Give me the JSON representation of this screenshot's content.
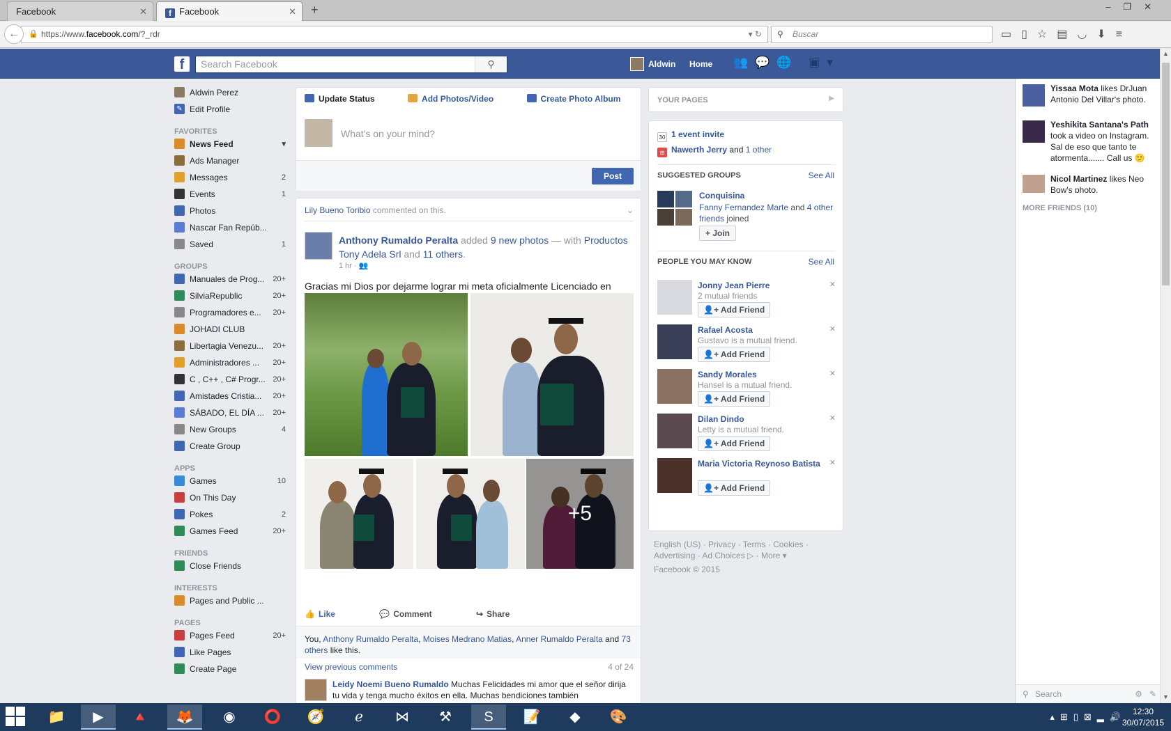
{
  "browser": {
    "tabs": [
      {
        "title": "Facebook"
      },
      {
        "title": "Facebook"
      }
    ],
    "url_prefix": "https://www.",
    "url_host": "facebook.com",
    "url_path": "/?_rdr",
    "search_placeholder": "Buscar"
  },
  "fbbar": {
    "search_placeholder": "Search Facebook",
    "user_name": "Aldwin",
    "home_label": "Home"
  },
  "leftnav": {
    "profile_name": "Aldwin Perez",
    "edit_profile": "Edit Profile",
    "favorites_header": "FAVORITES",
    "favorites": [
      {
        "label": "News Feed",
        "count": ""
      },
      {
        "label": "Ads Manager",
        "count": ""
      },
      {
        "label": "Messages",
        "count": "2"
      },
      {
        "label": "Events",
        "count": "1"
      },
      {
        "label": "Photos",
        "count": ""
      },
      {
        "label": "Nascar Fan Repúb...",
        "count": ""
      },
      {
        "label": "Saved",
        "count": "1"
      }
    ],
    "groups_header": "GROUPS",
    "groups": [
      {
        "label": "Manuales de Prog...",
        "count": "20+"
      },
      {
        "label": "SilviaRepublic",
        "count": "20+"
      },
      {
        "label": "Programadores e...",
        "count": "20+"
      },
      {
        "label": "JOHADI CLUB",
        "count": ""
      },
      {
        "label": "Libertagia Venezu...",
        "count": "20+"
      },
      {
        "label": "Administradores ...",
        "count": "20+"
      },
      {
        "label": "C , C++ , C# Progr...",
        "count": "20+"
      },
      {
        "label": "Amistades Cristia...",
        "count": "20+"
      },
      {
        "label": "SÁBADO, EL DÍA ...",
        "count": "20+"
      },
      {
        "label": "New Groups",
        "count": "4"
      },
      {
        "label": "Create Group",
        "count": ""
      }
    ],
    "apps_header": "APPS",
    "apps": [
      {
        "label": "Games",
        "count": "10"
      },
      {
        "label": "On This Day",
        "count": ""
      },
      {
        "label": "Pokes",
        "count": "2"
      },
      {
        "label": "Games Feed",
        "count": "20+"
      }
    ],
    "friends_header": "FRIENDS",
    "friends": [
      {
        "label": "Close Friends",
        "count": ""
      }
    ],
    "interests_header": "INTERESTS",
    "interests": [
      {
        "label": "Pages and Public ...",
        "count": ""
      }
    ],
    "pages_header": "PAGES",
    "pages": [
      {
        "label": "Pages Feed",
        "count": "20+"
      },
      {
        "label": "Like Pages",
        "count": ""
      },
      {
        "label": "Create Page",
        "count": ""
      }
    ]
  },
  "composer": {
    "tab_update": "Update Status",
    "tab_photos": "Add Photos/Video",
    "tab_album": "Create Photo Album",
    "placeholder": "What's on your mind?",
    "post_label": "Post"
  },
  "story": {
    "context_name": "Lily Bueno Toribio",
    "context_text": "commented on this.",
    "author": "Anthony Rumaldo Peralta",
    "added": "added",
    "photos_link": "9 new photos",
    "with": "— with",
    "tagged": "Productos Tony Adela Srl",
    "and": "and",
    "others_link": "11 others",
    "time": "1 hr",
    "text": "Gracias mi Dios por dejarme lograr mi meta oficialmente Licenciado en enfermería mi Dios es bueno",
    "more_photos": "+5",
    "like": "Like",
    "comment": "Comment",
    "share": "Share",
    "likes_you": "You,",
    "likes_names": [
      "Anthony Rumaldo Peralta",
      "Moises Medrano Matias",
      "Anner Rumaldo Peralta"
    ],
    "likes_and": "and",
    "likes_others": "73 others",
    "likes_suffix": "like this.",
    "view_previous": "View previous comments",
    "comment_count": "4 of 24",
    "commenter": "Leidy Noemi Bueno Rumaldo",
    "comment_text": "Muchas Felicidades mi amor que el señor dirija tu vida y tenga mucho éxitos en ella. Muchas bendiciones también"
  },
  "rightcol": {
    "your_pages": "YOUR PAGES",
    "event_invite": "1 event invite",
    "birthday_name": "Nawerth Jerry",
    "birthday_and": "and",
    "birthday_other": "1 other",
    "suggested_groups": "SUGGESTED GROUPS",
    "see_all": "See All",
    "group_name": "Conquisina",
    "group_joined_name": "Fanny Fernandez Marte",
    "group_joined_and": "and",
    "group_joined_others": "4 other friends",
    "group_joined_suffix": "joined",
    "join_label": "+ Join",
    "pymk_header": "PEOPLE YOU MAY KNOW",
    "pymk": [
      {
        "name": "Jonny Jean Pierre",
        "mutual": "2 mutual friends"
      },
      {
        "name": "Rafael Acosta",
        "mutual": "Gustavo is a mutual friend."
      },
      {
        "name": "Sandy Morales",
        "mutual": "Hansel is a mutual friend."
      },
      {
        "name": "Dilan Dindo",
        "mutual": "Letty is a mutual friend."
      },
      {
        "name": "Maria Victoria Reynoso Batista",
        "mutual": ""
      }
    ],
    "add_friend": "Add Friend",
    "footer_line1": "English (US) · Privacy · Terms · Cookies ·",
    "footer_line2": "Advertising · Ad Choices ▷ · More ▾",
    "footer_copy": "Facebook © 2015"
  },
  "ticker": {
    "items": [
      {
        "name": "Yissaa Mota",
        "text": "likes DrJuan Antonio Del Villar's photo."
      },
      {
        "name": "Yeshikita Santana's Path",
        "text": "took a video on Instagram. Sal de eso que tanto te atormenta....... Call us 🙂"
      },
      {
        "name": "Nicol Martinez",
        "text": "likes Neo Bow's photo."
      }
    ],
    "more_friends": "MORE FRIENDS (10)",
    "chat_search": "Search"
  },
  "taskbar": {
    "time": "12:30",
    "date": "30/07/2015"
  },
  "colors": {
    "fb_blue": "#3b5998",
    "link": "#365899",
    "taskbar": "#1e3b5e"
  }
}
